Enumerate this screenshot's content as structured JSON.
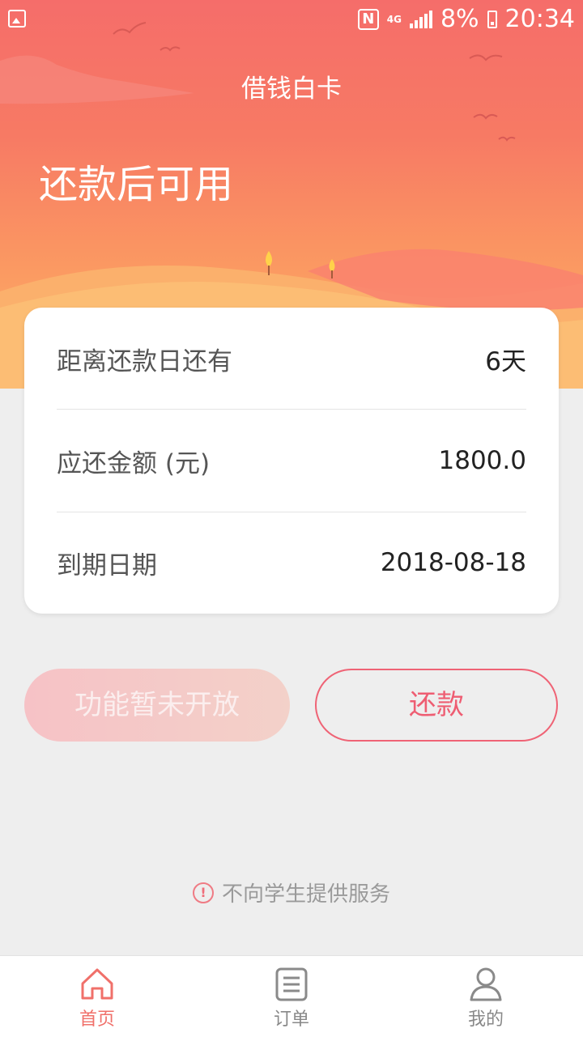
{
  "status_bar": {
    "battery": "8%",
    "time": "20:34",
    "network": "4G"
  },
  "header": {
    "title": "借钱白卡",
    "headline": "还款后可用"
  },
  "summary": {
    "days_label": "距离还款日还有",
    "days_value": "6天",
    "amount_label": "应还金额 (元)",
    "amount_value": "1800.0",
    "due_label": "到期日期",
    "due_value": "2018-08-18"
  },
  "actions": {
    "disabled_label": "功能暂未开放",
    "repay_label": "还款"
  },
  "notice": {
    "text": "不向学生提供服务"
  },
  "tabbar": {
    "items": [
      {
        "label": "首页",
        "icon": "home-icon",
        "active": true
      },
      {
        "label": "订单",
        "icon": "document-icon",
        "active": false
      },
      {
        "label": "我的",
        "icon": "person-icon",
        "active": false
      }
    ]
  },
  "colors": {
    "accent": "#f0706a",
    "repay_border": "#ef6375",
    "hero_top": "#f56d6a",
    "hero_bottom": "#fcb46a"
  }
}
